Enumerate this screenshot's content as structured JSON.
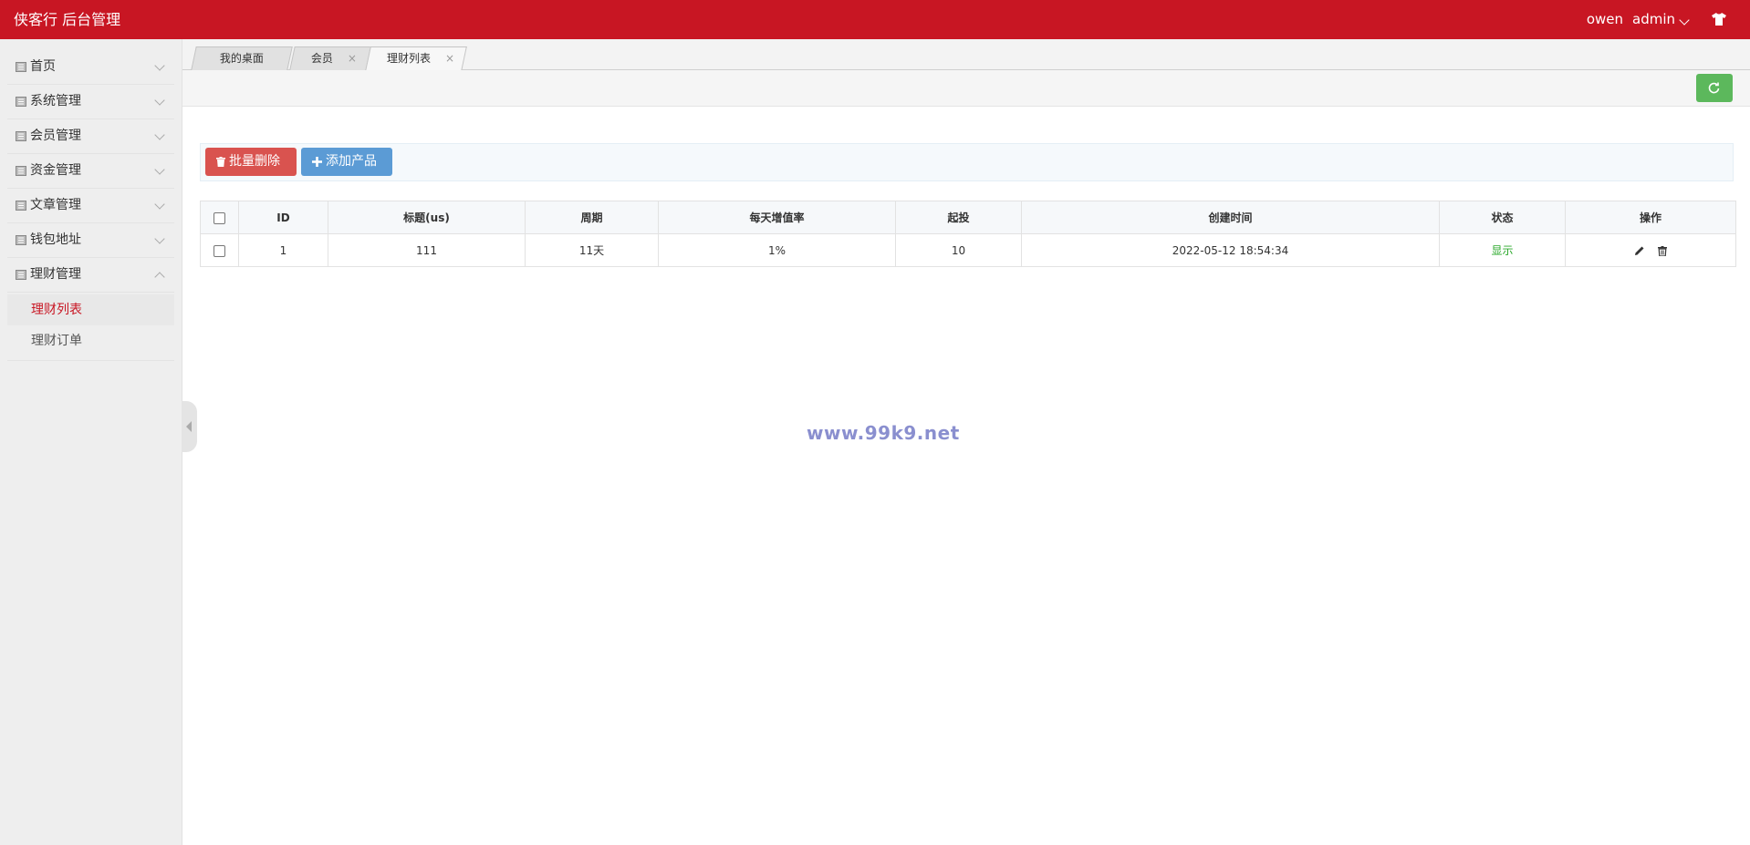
{
  "header": {
    "brand": "侠客行 后台管理",
    "user": "owen",
    "account": "admin",
    "icon": "shirt-icon",
    "color": "#c81623"
  },
  "sidebar": {
    "items": [
      {
        "label": "首页",
        "icon": "page-icon"
      },
      {
        "label": "系统管理",
        "icon": "page-icon"
      },
      {
        "label": "会员管理",
        "icon": "page-icon"
      },
      {
        "label": "资金管理",
        "icon": "page-icon"
      },
      {
        "label": "文章管理",
        "icon": "page-icon"
      },
      {
        "label": "钱包地址",
        "icon": "page-icon"
      },
      {
        "label": "理财管理",
        "icon": "page-icon",
        "expanded": true
      }
    ],
    "subitems": [
      {
        "label": "理财列表",
        "active": true
      },
      {
        "label": "理财订单",
        "active": false
      }
    ]
  },
  "tabs": [
    {
      "label": "我的桌面",
      "closable": false
    },
    {
      "label": "会员",
      "closable": true
    },
    {
      "label": "理财列表",
      "closable": true,
      "active": true
    }
  ],
  "tab_close_glyph": "×",
  "toolbar": {
    "batch_delete": "批量删除",
    "add_product": "添加产品"
  },
  "table": {
    "columns": [
      "ID",
      "标题(us)",
      "周期",
      "每天增值率",
      "起投",
      "创建时间",
      "状态",
      "操作"
    ],
    "rows": [
      {
        "id": "1",
        "title": "111",
        "period": "11天",
        "rate": "1%",
        "min": "10",
        "created": "2022-05-12 18:54:34",
        "status": "显示"
      }
    ]
  },
  "watermark": "www.99k9.net"
}
